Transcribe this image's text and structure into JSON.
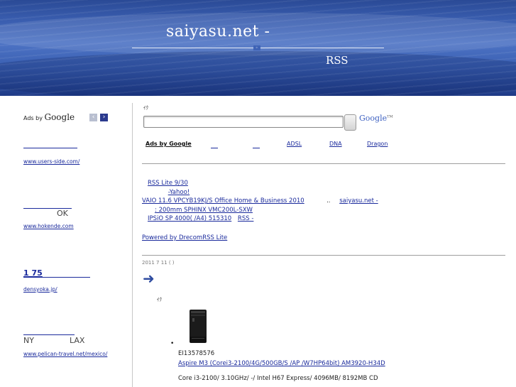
{
  "header": {
    "site_title": "saiyasu.net -",
    "rss_title": "RSS"
  },
  "sidebar": {
    "ads_by": "Ads by",
    "google": "Google",
    "prev_glyph": "‹",
    "next_glyph": "›",
    "ads": [
      {
        "title": "",
        "url": "www.users-side.com/"
      },
      {
        "title": "OK",
        "url": "www.hokende.com"
      },
      {
        "title": "1 75",
        "url": "densyoka.jp/"
      },
      {
        "title_left": "NY",
        "title_right": "LAX",
        "url": "www.pelican-travel.net/mexico/"
      }
    ]
  },
  "search": {
    "label": "ｲｸ",
    "value": "",
    "google_logo": "Google",
    "tm": "TM"
  },
  "ad_links": {
    "ads_by_google": "Ads by Google",
    "items": [
      "",
      "",
      "ADSL",
      "DNA",
      "Dragon"
    ]
  },
  "rss_items": [
    {
      "text": "RSS Lite 9/30"
    },
    {
      "text": "-Yahoo!"
    },
    {
      "text": "VAIO 11.6        VPCYB19KJ/S Office Home & Business 2010",
      "extra": "saiyasu.net -"
    },
    {
      "text": ": 200mm    SPHINX VMC200L-SXW"
    },
    {
      "text": "IPSiO SP 4000(          /A4) 515310",
      "extra": "RSS  -"
    },
    {
      "text": ""
    }
  ],
  "powered_by": "Powered by DrecomRSS Lite",
  "post": {
    "date": "2011 7  11  ( )",
    "small_label": "ｲｸ",
    "bullet": "•",
    "code": "EI13578576",
    "link": "Aspire M3 (Corei3-2100/4G/500GB/S   /AP  /W7HP64bit) AM3920-H34D",
    "spec": "Core i3-2100/ 3.10GHz/ -/ Intel H67 Express/ 4096MB/ 8192MB    CD"
  },
  "colors": {
    "header_blue": "#3a5eb0",
    "link_blue": "#1a2a9c",
    "arrow_blue": "#2f4ca0"
  }
}
